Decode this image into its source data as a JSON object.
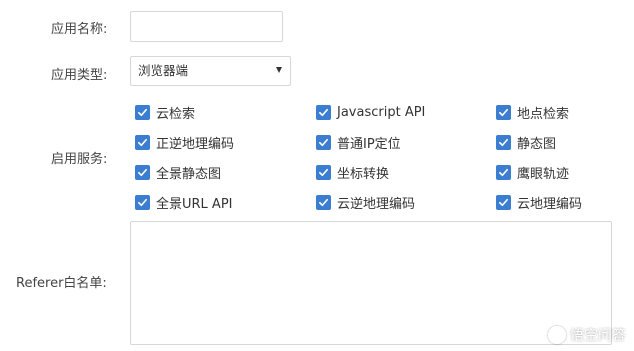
{
  "form": {
    "app_name": {
      "label": "应用名称:",
      "value": ""
    },
    "app_type": {
      "label": "应用类型:",
      "selected": "浏览器端"
    },
    "services": {
      "label": "启用服务:",
      "items": [
        {
          "label": "云检索",
          "checked": true
        },
        {
          "label": "Javascript API",
          "checked": true
        },
        {
          "label": "地点检索",
          "checked": true
        },
        {
          "label": "正逆地理编码",
          "checked": true
        },
        {
          "label": "普通IP定位",
          "checked": true
        },
        {
          "label": "静态图",
          "checked": true
        },
        {
          "label": "全景静态图",
          "checked": true
        },
        {
          "label": "坐标转换",
          "checked": true
        },
        {
          "label": "鹰眼轨迹",
          "checked": true
        },
        {
          "label": "全景URL API",
          "checked": true
        },
        {
          "label": "云逆地理编码",
          "checked": true
        },
        {
          "label": "云地理编码",
          "checked": true
        }
      ]
    },
    "referer": {
      "label": "Referer白名单:",
      "value": ""
    }
  },
  "watermark": {
    "text": "悟空问答"
  },
  "colors": {
    "checkbox": "#3a7dd1",
    "border": "#d7d7d7",
    "label": "#444444"
  }
}
